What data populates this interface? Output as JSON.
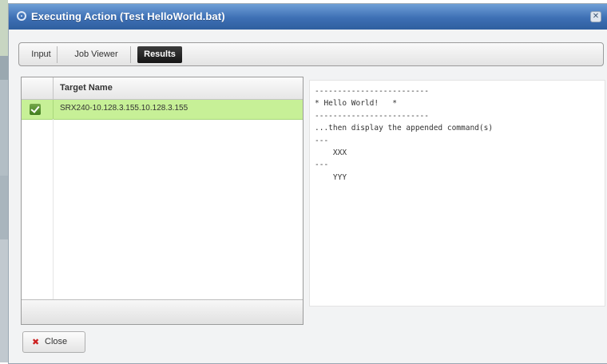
{
  "window": {
    "title": "Executing Action (Test HelloWorld.bat)",
    "accent_color": "#3d6fb4"
  },
  "tabs": [
    {
      "label": "Input",
      "active": false
    },
    {
      "label": "Job Viewer",
      "active": false
    },
    {
      "label": "Results",
      "active": true
    }
  ],
  "targets": {
    "header": "Target Name",
    "rows": [
      {
        "checked": true,
        "name": "SRX240-10.128.3.155.10.128.3.155"
      }
    ],
    "selected_row_color": "#c7f097"
  },
  "results": {
    "output": "-------------------------\n* Hello World!   *\n-------------------------\n...then display the appended command(s)\n---\n    XXX\n---\n    YYY"
  },
  "footer": {
    "close_label": "Close"
  },
  "icons": {
    "title": "action-icon",
    "window_close": "close-icon",
    "close_button": "x-icon"
  }
}
